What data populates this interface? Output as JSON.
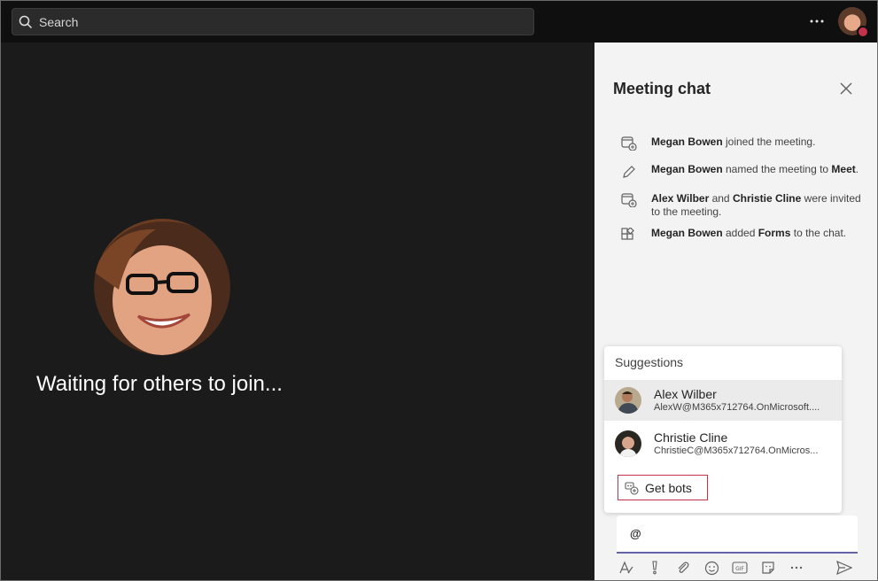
{
  "search": {
    "placeholder": "Search"
  },
  "stage": {
    "waiting_text": "Waiting for others to join..."
  },
  "chat": {
    "title": "Meeting chat",
    "events": [
      {
        "parts": [
          {
            "text": "Megan Bowen",
            "bold": true
          },
          {
            "text": " joined the meeting."
          }
        ]
      },
      {
        "parts": [
          {
            "text": "Megan Bowen",
            "bold": true
          },
          {
            "text": " named the meeting to "
          },
          {
            "text": "Meet",
            "bold": true
          },
          {
            "text": "."
          }
        ]
      },
      {
        "parts": [
          {
            "text": "Alex Wilber",
            "bold": true
          },
          {
            "text": " and "
          },
          {
            "text": "Christie Cline",
            "bold": true
          },
          {
            "text": " were invited to the meeting."
          }
        ]
      },
      {
        "parts": [
          {
            "text": "Megan Bowen",
            "bold": true
          },
          {
            "text": " added "
          },
          {
            "text": "Forms",
            "bold": true
          },
          {
            "text": " to the chat."
          }
        ]
      }
    ],
    "suggestions": {
      "heading": "Suggestions",
      "people": [
        {
          "name": "Alex Wilber",
          "email": "AlexW@M365x712764.OnMicrosoft...."
        },
        {
          "name": "Christie Cline",
          "email": "ChristieC@M365x712764.OnMicros..."
        }
      ],
      "get_bots_label": "Get bots"
    },
    "compose": {
      "value": "@"
    }
  },
  "colors": {
    "accent": "#6264a7",
    "presence_busy": "#c4314b",
    "highlight_border": "#c4314b"
  }
}
